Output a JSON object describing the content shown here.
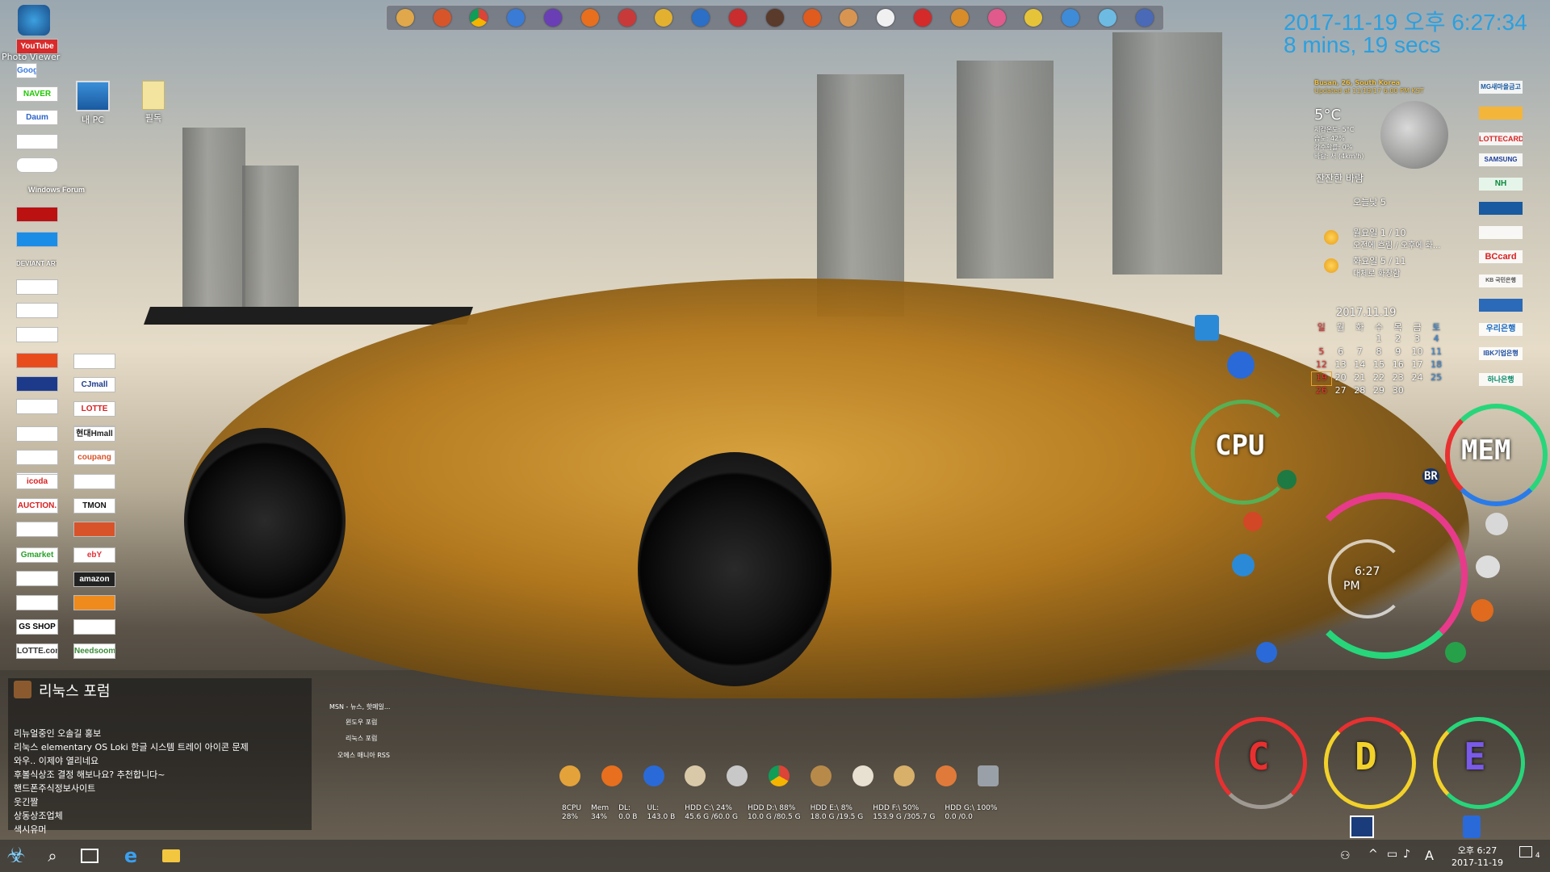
{
  "top_dock": {
    "icons": [
      "app-icon",
      "photo-icon",
      "chrome-icon",
      "wrench-icon",
      "media-icon",
      "firefox-icon",
      "paint-icon",
      "cd-icon",
      "globe-icon",
      "flash-icon",
      "skull-icon",
      "settings-icon",
      "craft-icon",
      "pacman-icon",
      "red-icon",
      "disc-icon",
      "puzzle-icon",
      "pencil-icon",
      "search-icon",
      "water-icon",
      "tool-icon"
    ]
  },
  "desktop": {
    "icons": [
      {
        "label": "내 PC"
      },
      {
        "label": "필독"
      }
    ],
    "photo_viewer_label": "Photo Viewer"
  },
  "left_tiles": {
    "col1": [
      "YouTube",
      "Google",
      "NAVER",
      "Daum",
      "",
      "",
      "Windows Forum",
      "",
      "",
      "DEVIANT ART",
      "",
      "",
      "",
      "",
      "",
      "",
      "",
      "",
      "",
      "icoda",
      "AUCTION.",
      "",
      "Gmarket",
      "",
      "",
      "GS SHOP",
      "LOTTE.com"
    ],
    "col2": [
      "",
      "CJmall",
      "LOTTE",
      "",
      "현대Hmall",
      "coupang",
      "",
      "TMON",
      "",
      "ebY",
      "amazon",
      "",
      "",
      "Needsoom"
    ]
  },
  "news": {
    "title": "리눅스 포럼",
    "items": [
      "리뉴얼중인 오솔길 홍보",
      "리눅스 elementary OS Loki 한글 시스템 트레이 아이콘 문제",
      "와우.. 이제야 열리네요",
      "후볼식상조 결정 해보나요? 추천합니다~",
      "핸드폰주식정보사이트",
      "웃긴짤",
      "상동상조업체",
      "색시유머"
    ],
    "side_items": [
      "MSN - 뉴스, 핫메일...",
      "윈도우 포럼",
      "리눅스 포럼",
      "오에스 매니아 RSS"
    ]
  },
  "clock": {
    "datetime": "2017-11-19 오후 6:27:34",
    "uptime": "8 mins, 19 secs",
    "analog_time": "6:27",
    "analog_ampm": "PM"
  },
  "weather": {
    "location": "Busan, 26, South Korea",
    "updated": "Updated at 11/19/17 6:00 PM KST",
    "temp": "5°C",
    "details": [
      "체감온도: 5°C",
      "습도: 42%",
      "강수확률: 0%",
      "바람: 서 (4km/h)"
    ],
    "condition": "잔잔한 바람",
    "today": "오늘낮 5",
    "forecast": [
      {
        "day": "월요일 1 / 10",
        "desc": "오전에 흐림 / 오후에 화..."
      },
      {
        "day": "화요일 5 / 11",
        "desc": "대체로 화창함"
      }
    ]
  },
  "calendar": {
    "title": "2017.11.19",
    "weekdays": [
      "일",
      "월",
      "화",
      "수",
      "목",
      "금",
      "토"
    ],
    "weeks": [
      [
        "",
        "",
        "",
        "1",
        "2",
        "3",
        "4"
      ],
      [
        "5",
        "6",
        "7",
        "8",
        "9",
        "10",
        "11"
      ],
      [
        "12",
        "13",
        "14",
        "15",
        "16",
        "17",
        "18"
      ],
      [
        "19",
        "20",
        "21",
        "22",
        "23",
        "24",
        "25"
      ],
      [
        "26",
        "27",
        "28",
        "29",
        "30",
        "",
        ""
      ]
    ]
  },
  "banks": [
    "MG새마을금고",
    "",
    "LOTTECARD",
    "SAMSUNG",
    "NH",
    "",
    "",
    "BCcard",
    "KB 국민은행",
    "",
    "우리은행",
    "IBK기업은행",
    "하나은행"
  ],
  "gauges": {
    "cpu_label": "CPU",
    "mem_label": "MEM",
    "drives": [
      "C",
      "D",
      "E"
    ],
    "badge": "BR"
  },
  "stats": [
    {
      "label": "8CPU",
      "value": "28%"
    },
    {
      "label": "Mem",
      "value": "34%"
    },
    {
      "label": "DL:",
      "value": "0.0 B"
    },
    {
      "label": "UL:",
      "value": "143.0 B"
    },
    {
      "label": "HDD C:\\  24%",
      "value": "45.6 G  /60.0 G"
    },
    {
      "label": "HDD D:\\  88%",
      "value": "10.0 G  /80.5 G"
    },
    {
      "label": "HDD E:\\  8%",
      "value": "18.0 G  /19.5 G"
    },
    {
      "label": "HDD F:\\  50%",
      "value": "153.9 G /305.7 G"
    },
    {
      "label": "HDD G:\\  100%",
      "value": "0.0    /0.0"
    }
  ],
  "taskbar": {
    "tray_time": "오후 6:27",
    "tray_date": "2017-11-19",
    "ime": "A",
    "notification_count": "4"
  },
  "colors": {
    "clock_blue": "#2aa0e0",
    "gauge_green": "#27d67a",
    "gauge_red": "#e83030",
    "gauge_yellow": "#f2d12a"
  }
}
